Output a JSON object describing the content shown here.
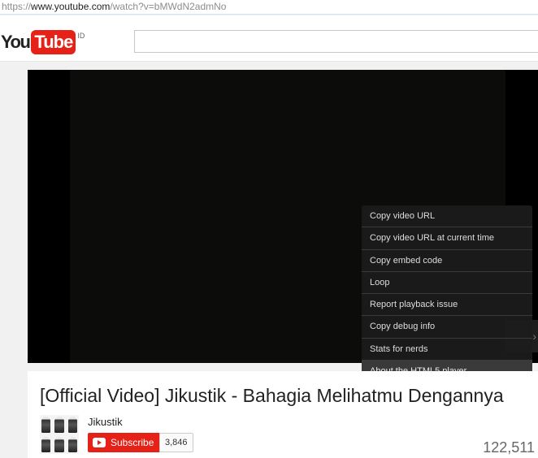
{
  "address_bar": {
    "scheme": "https://",
    "host": "www.youtube.com",
    "path": "/watch?v=bMWdN2admNo"
  },
  "masthead": {
    "logo_you": "You",
    "logo_tube": "Tube",
    "region": "ID",
    "search_placeholder": ""
  },
  "context_menu": {
    "items": [
      "Copy video URL",
      "Copy video URL at current time",
      "Copy embed code",
      "Loop",
      "Report playback issue",
      "Copy debug info",
      "Stats for nerds",
      "About the HTML5 player"
    ]
  },
  "video": {
    "title": "[Official Video] Jikustik - Bahagia Melihatmu Dengannya",
    "channel": "Jikustik",
    "subscribe_label": "Subscribe",
    "subscriber_count": "3,846",
    "view_count": "122,511"
  },
  "colors": {
    "brand_red": "#e62117",
    "player_bg": "#000000",
    "menu_bg": "#1c1c1c"
  },
  "icons": {
    "scroll": "chevron-right-icon",
    "subscribe": "youtube-play-icon"
  }
}
